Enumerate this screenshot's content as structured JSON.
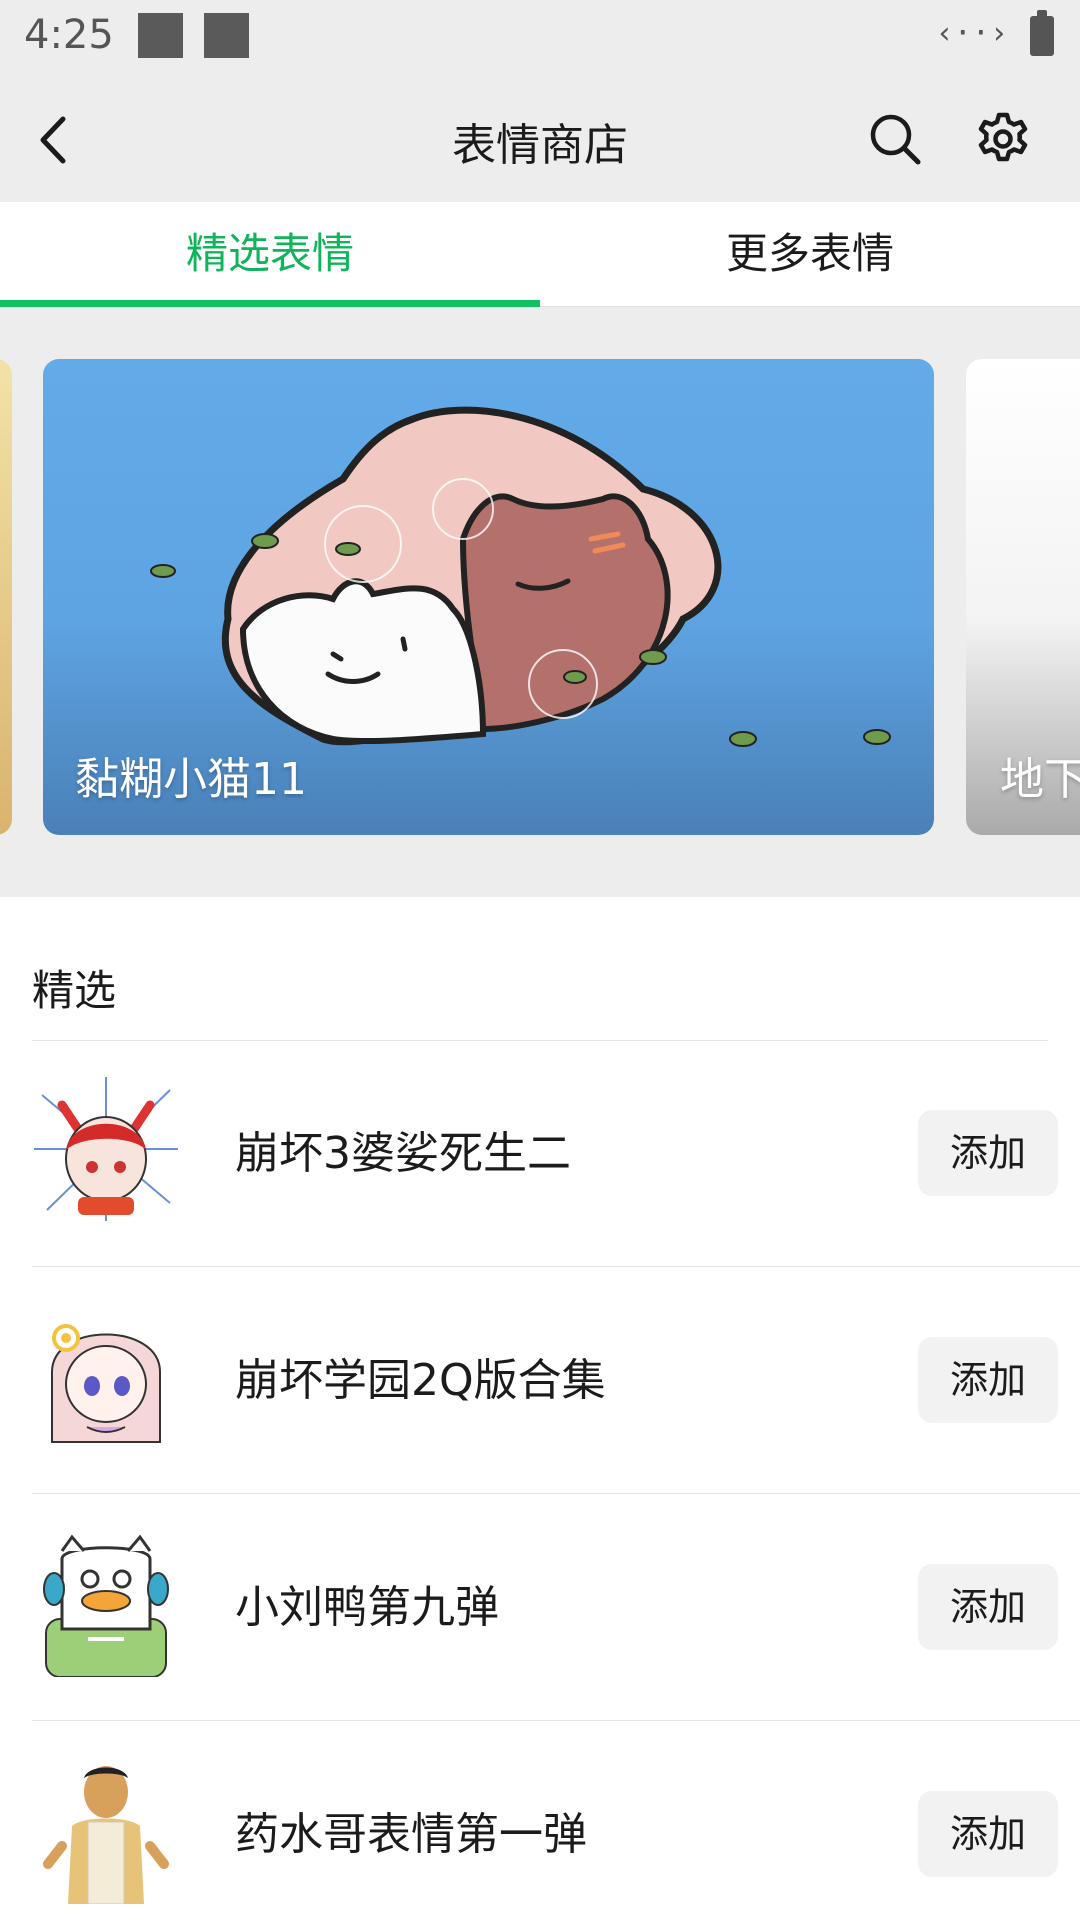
{
  "status_bar": {
    "time": "4:25",
    "network_glyph": "‹··›"
  },
  "header": {
    "title": "表情商店",
    "back_icon": "back-chevron-icon",
    "search_icon": "search-icon",
    "settings_icon": "gear-icon"
  },
  "tabs": [
    {
      "label": "精选表情",
      "active": true
    },
    {
      "label": "更多表情",
      "active": false
    }
  ],
  "carousel": {
    "banners": [
      {
        "title": "黏糊小猫11"
      },
      {
        "title": "地下"
      }
    ]
  },
  "section": {
    "title": "精选",
    "items": [
      {
        "name": "崩坏3婆娑死生二",
        "button": "添加"
      },
      {
        "name": "崩坏学园2Q版合集",
        "button": "添加"
      },
      {
        "name": "小刘鸭第九弹",
        "button": "添加"
      },
      {
        "name": "药水哥表情第一弹",
        "button": "添加"
      }
    ]
  },
  "colors": {
    "accent": "#10c160",
    "accent_text": "#10b45a",
    "background": "#ededed"
  }
}
